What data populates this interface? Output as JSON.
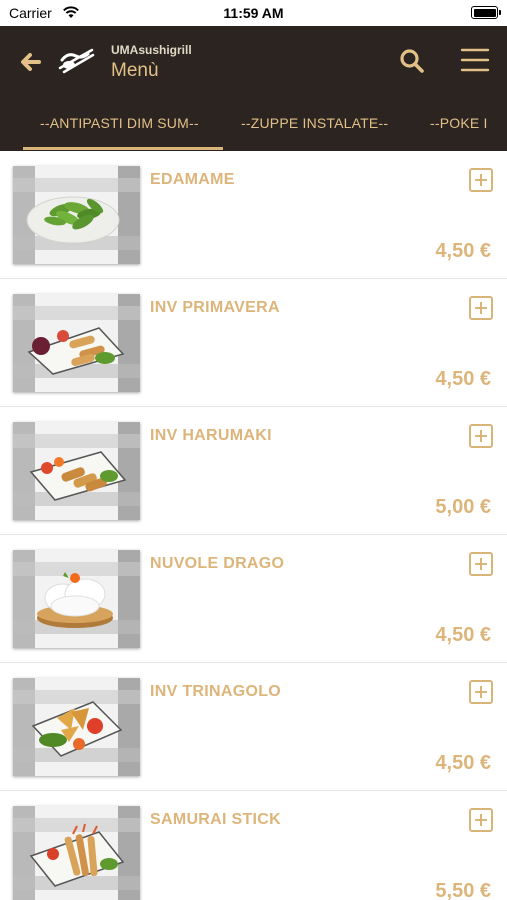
{
  "status_bar": {
    "carrier": "Carrier",
    "time": "11:59 AM"
  },
  "header": {
    "restaurant_name": "UMAsushigrill",
    "title": "Menù",
    "icons": {
      "back": "arrow-left-icon",
      "logo": "chopsticks-logo",
      "search": "search-icon",
      "menu": "hamburger-menu-icon"
    }
  },
  "tabs": [
    {
      "label": "--ANTIPASTI DIM SUM--",
      "selected": true
    },
    {
      "label": "--ZUPPE INSTALATE--",
      "selected": false
    },
    {
      "label": "--POKE I",
      "selected": false
    }
  ],
  "items": [
    {
      "name": "EDAMAME",
      "price": "4,50 €"
    },
    {
      "name": "INV PRIMAVERA",
      "price": "4,50 €"
    },
    {
      "name": "INV HARUMAKI",
      "price": "5,00 €"
    },
    {
      "name": "NUVOLE DRAGO",
      "price": "4,50 €"
    },
    {
      "name": "INV TRINAGOLO",
      "price": "4,50 €"
    },
    {
      "name": "SAMURAI STICK",
      "price": "5,50 €"
    }
  ],
  "colors": {
    "header_bg": "#2b2421",
    "accent": "#ddb57a",
    "tab_text": "#e2c087"
  }
}
